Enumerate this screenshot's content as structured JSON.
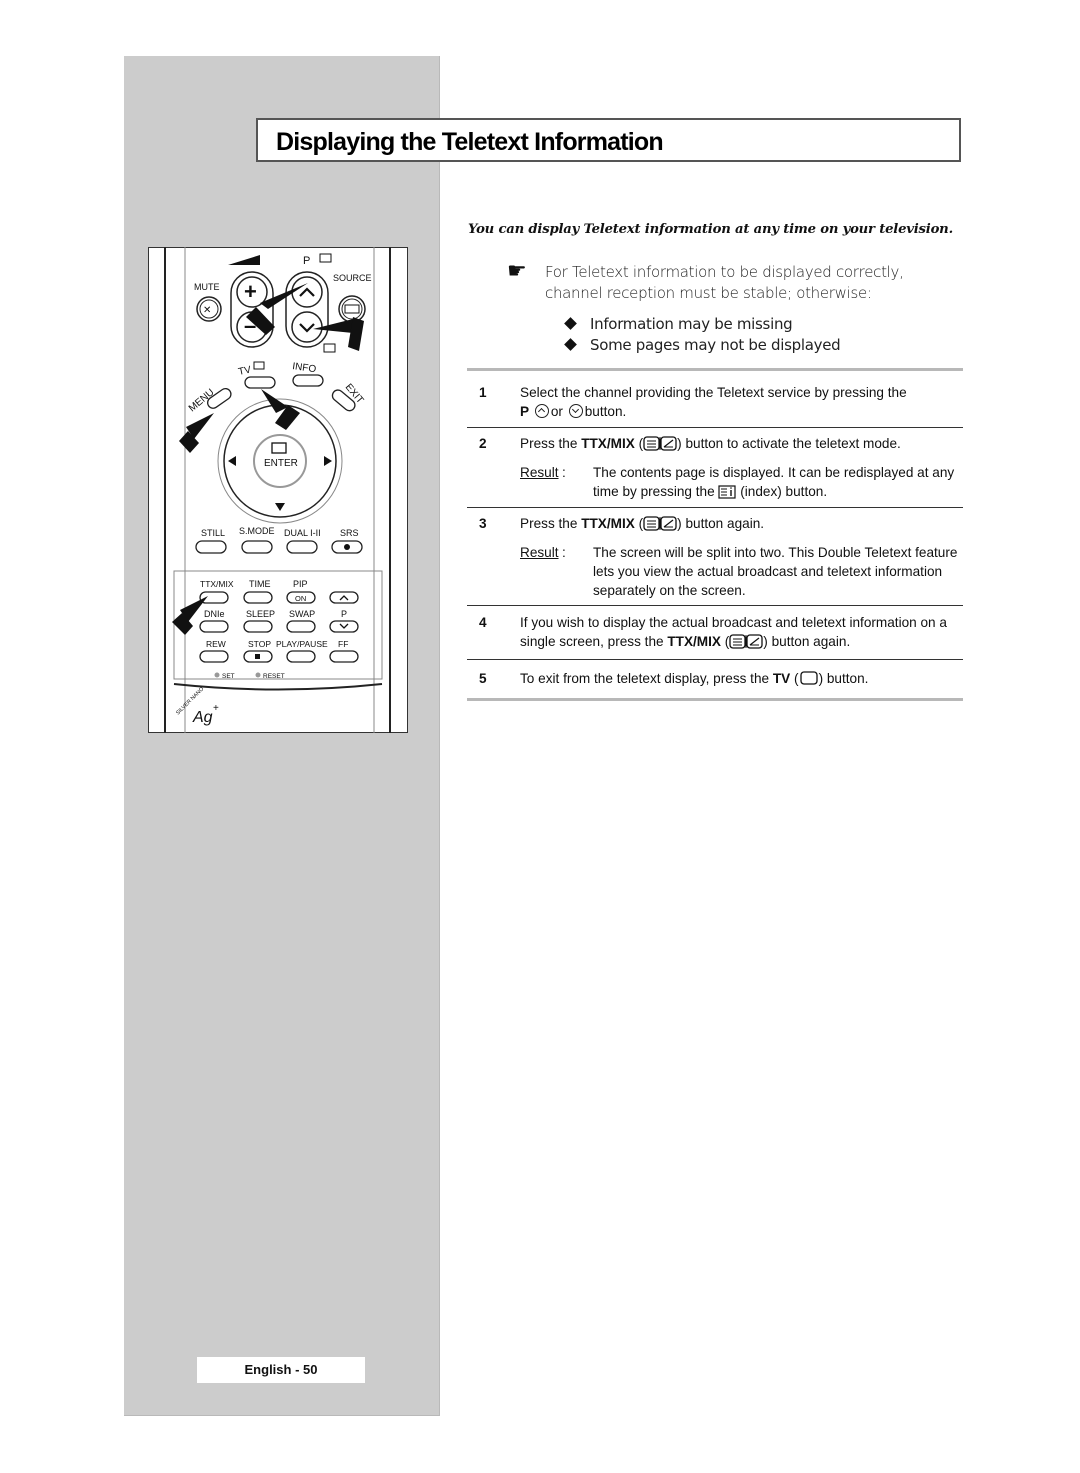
{
  "page": {
    "title": "Displaying the Teletext Information",
    "intro": "You can display Teletext information at any time on your television.",
    "note": {
      "icon": "pointing-hand-icon",
      "text": "For Teletext information to be displayed correctly, channel reception must be stable; otherwise:",
      "bullets": [
        "Information may be missing",
        "Some pages may not be displayed"
      ]
    },
    "steps": [
      {
        "number": "1",
        "text_a": "Select the channel providing the Teletext service by pressing the",
        "key_p": "P",
        "text_or": "or",
        "text_b": "button."
      },
      {
        "number": "2",
        "text_a": "Press the",
        "key": "TTX/MIX",
        "text_b": "button to activate the teletext mode.",
        "result_label": "Result",
        "result_a": "The contents page is displayed. It can be redisplayed at any time by pressing the",
        "result_b": "(index) button."
      },
      {
        "number": "3",
        "text_a": "Press the",
        "key": "TTX/MIX",
        "text_b": "button again.",
        "result_label": "Result",
        "result_a": "The screen will be split into two. This Double Teletext feature lets you view the actual broadcast and teletext information separately on the screen."
      },
      {
        "number": "4",
        "text_a": "If you wish to display the actual broadcast and teletext information on a single screen, press the",
        "key": "TTX/MIX",
        "text_b": "button again."
      },
      {
        "number": "5",
        "text_a": "To exit from the teletext display, press the",
        "key": "TV",
        "text_b": "button."
      }
    ],
    "footer": "English - 50"
  },
  "remote": {
    "labels": {
      "mute": "MUTE",
      "p": "P",
      "source": "SOURCE",
      "tv": "TV",
      "info": "INFO",
      "menu": "MENU",
      "exit": "EXIT",
      "enter": "ENTER",
      "still": "STILL",
      "smode": "S.MODE",
      "dual": "DUAL I-II",
      "srs": "SRS",
      "ttxmix": "TTX/MIX",
      "time": "TIME",
      "pip": "PIP",
      "pip_on": "ON",
      "dnie": "DNIe",
      "sleep": "SLEEP",
      "swap": "SWAP",
      "p2": "P",
      "rew": "REW",
      "stop": "STOP",
      "playpause": "PLAY/PAUSE",
      "ff": "FF",
      "set": "SET",
      "reset": "RESET",
      "brand_arc": "SILVER NANO",
      "brand": "Ag"
    }
  }
}
